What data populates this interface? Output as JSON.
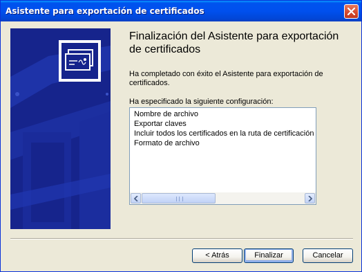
{
  "window": {
    "title": "Asistente para exportación de certificados"
  },
  "wizard": {
    "heading": "Finalización del Asistente para exportación de certificados",
    "completed_text": "Ha completado con éxito el Asistente para exportación de certificados.",
    "config_label": "Ha especificado la siguiente configuración:",
    "config_items": [
      "Nombre de archivo",
      "Exportar claves",
      "Incluir todos los certificados en la ruta de certificación",
      "Formato de archivo"
    ]
  },
  "buttons": {
    "back": "< Atrás",
    "finish": "Finalizar",
    "cancel": "Cancelar"
  },
  "icons": {
    "close": "close-icon",
    "certificate": "certificate-icon",
    "scroll_left": "arrow-left-icon",
    "scroll_right": "arrow-right-icon"
  },
  "colors": {
    "titlebar": "#0053ee",
    "side_panel": "#16248c",
    "close_button": "#d6472c"
  }
}
